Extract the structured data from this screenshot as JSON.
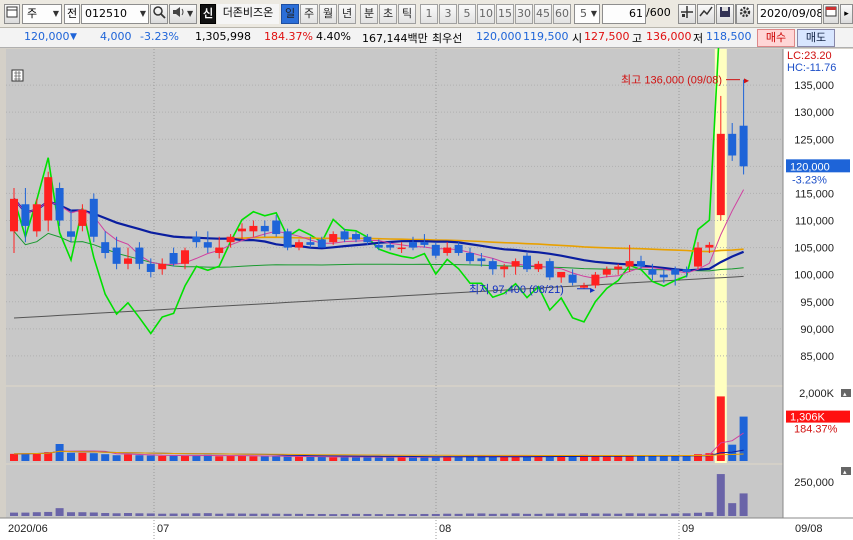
{
  "toolbar": {
    "period_selector": "주",
    "market_selector": "전",
    "code": "012510",
    "stock_name": "더존비즈온",
    "credit_badge": "신",
    "periods": [
      "일",
      "주",
      "월",
      "년",
      "분",
      "초",
      "틱"
    ],
    "active_period": "일",
    "intervals": [
      "1",
      "3",
      "5",
      "10",
      "15",
      "30",
      "45",
      "60"
    ],
    "interval_value": "5",
    "count_value": "61",
    "count_max": "/600",
    "date": "2020/09/08"
  },
  "quote": {
    "price": "120,000",
    "change": "4,000",
    "change_pct": "-3.23%",
    "volume": "1,305,998",
    "volume_ratio": "184.37%",
    "turnover": "4.40%",
    "amount": "167,144백만",
    "priority_label": "최우선",
    "best_ask": "120,000",
    "best_bid": "119,500",
    "open_label": "시",
    "open": "127,500",
    "high_label": "고",
    "high": "136,000",
    "low_label": "저",
    "low": "118,500",
    "buy_label": "매수",
    "sell_label": "매도"
  },
  "chart_data": {
    "type": "candlestick",
    "price_axis": {
      "ylim": [
        80000,
        140000
      ],
      "ticks": [
        "135,000",
        "130,000",
        "125,000",
        "120,000",
        "115,000",
        "110,000",
        "105,000",
        "100,000",
        "95,000",
        "90,000",
        "85,000"
      ]
    },
    "lc_label": "LC:23.20",
    "hc_label": "HC:-11.76",
    "current_price_label": "120,000",
    "current_change_label": "-3.23%",
    "high_annotation": "최고 136,000 (09/08)",
    "low_annotation": "최저 97,400 (08/21)",
    "x_labels": [
      "2020/06",
      "07",
      "08",
      "09",
      "09/08"
    ],
    "candles": [
      {
        "o": 108000,
        "h": 116000,
        "l": 104000,
        "c": 114000
      },
      {
        "o": 113000,
        "h": 116000,
        "l": 106000,
        "c": 109000
      },
      {
        "o": 108000,
        "h": 114000,
        "l": 107000,
        "c": 113000
      },
      {
        "o": 110000,
        "h": 119000,
        "l": 108000,
        "c": 118000
      },
      {
        "o": 116000,
        "h": 117000,
        "l": 109000,
        "c": 110000
      },
      {
        "o": 108000,
        "h": 112000,
        "l": 106000,
        "c": 107000
      },
      {
        "o": 109000,
        "h": 113000,
        "l": 108000,
        "c": 112000
      },
      {
        "o": 114000,
        "h": 115000,
        "l": 106000,
        "c": 107000
      },
      {
        "o": 106000,
        "h": 108000,
        "l": 103000,
        "c": 104000
      },
      {
        "o": 105000,
        "h": 107000,
        "l": 101000,
        "c": 102000
      },
      {
        "o": 102000,
        "h": 105000,
        "l": 101000,
        "c": 103000
      },
      {
        "o": 105000,
        "h": 106000,
        "l": 101000,
        "c": 102000
      },
      {
        "o": 102000,
        "h": 103000,
        "l": 99500,
        "c": 100500
      },
      {
        "o": 101000,
        "h": 103000,
        "l": 100000,
        "c": 102000
      },
      {
        "o": 104000,
        "h": 105000,
        "l": 101500,
        "c": 102000
      },
      {
        "o": 102000,
        "h": 105000,
        "l": 101000,
        "c": 104500
      },
      {
        "o": 107000,
        "h": 108000,
        "l": 105000,
        "c": 106000
      },
      {
        "o": 106000,
        "h": 108000,
        "l": 104000,
        "c": 105000
      },
      {
        "o": 104000,
        "h": 107000,
        "l": 103000,
        "c": 105000
      },
      {
        "o": 106000,
        "h": 107500,
        "l": 105000,
        "c": 107000
      },
      {
        "o": 108000,
        "h": 109500,
        "l": 106500,
        "c": 108500
      },
      {
        "o": 108000,
        "h": 110000,
        "l": 107000,
        "c": 109000
      },
      {
        "o": 109000,
        "h": 110000,
        "l": 107000,
        "c": 108000
      },
      {
        "o": 110000,
        "h": 111000,
        "l": 107000,
        "c": 107500
      },
      {
        "o": 108000,
        "h": 108500,
        "l": 104500,
        "c": 105000
      },
      {
        "o": 105000,
        "h": 106500,
        "l": 104500,
        "c": 106000
      },
      {
        "o": 106000,
        "h": 107000,
        "l": 105000,
        "c": 105500
      },
      {
        "o": 106500,
        "h": 107000,
        "l": 105000,
        "c": 105000
      },
      {
        "o": 106000,
        "h": 108000,
        "l": 105500,
        "c": 107500
      },
      {
        "o": 108000,
        "h": 108500,
        "l": 106000,
        "c": 106500
      },
      {
        "o": 107500,
        "h": 108000,
        "l": 106000,
        "c": 106500
      },
      {
        "o": 107000,
        "h": 107500,
        "l": 105500,
        "c": 106000
      },
      {
        "o": 105500,
        "h": 106500,
        "l": 104500,
        "c": 105000
      },
      {
        "o": 105500,
        "h": 106000,
        "l": 104500,
        "c": 105000
      },
      {
        "o": 105000,
        "h": 106000,
        "l": 104000,
        "c": 105000
      },
      {
        "o": 106000,
        "h": 107000,
        "l": 104500,
        "c": 105000
      },
      {
        "o": 106000,
        "h": 107500,
        "l": 105000,
        "c": 105500
      },
      {
        "o": 105500,
        "h": 106000,
        "l": 103000,
        "c": 103500
      },
      {
        "o": 104000,
        "h": 106000,
        "l": 103500,
        "c": 105000
      },
      {
        "o": 105500,
        "h": 106000,
        "l": 103500,
        "c": 104000
      },
      {
        "o": 104000,
        "h": 105000,
        "l": 102000,
        "c": 102500
      },
      {
        "o": 103000,
        "h": 104000,
        "l": 101500,
        "c": 102500
      },
      {
        "o": 102500,
        "h": 103000,
        "l": 100000,
        "c": 101000
      },
      {
        "o": 101000,
        "h": 102000,
        "l": 99500,
        "c": 101500
      },
      {
        "o": 101500,
        "h": 103000,
        "l": 100000,
        "c": 102500
      },
      {
        "o": 103500,
        "h": 104000,
        "l": 100500,
        "c": 101000
      },
      {
        "o": 101000,
        "h": 102500,
        "l": 100500,
        "c": 102000
      },
      {
        "o": 102500,
        "h": 103000,
        "l": 99000,
        "c": 99500
      },
      {
        "o": 99500,
        "h": 100500,
        "l": 98500,
        "c": 100500
      },
      {
        "o": 100000,
        "h": 101000,
        "l": 98000,
        "c": 98500
      },
      {
        "o": 97600,
        "h": 98500,
        "l": 97400,
        "c": 98000
      },
      {
        "o": 98000,
        "h": 100500,
        "l": 97500,
        "c": 100000
      },
      {
        "o": 100000,
        "h": 101500,
        "l": 99500,
        "c": 101000
      },
      {
        "o": 101000,
        "h": 102000,
        "l": 100000,
        "c": 101500
      },
      {
        "o": 101500,
        "h": 105500,
        "l": 100500,
        "c": 102500
      },
      {
        "o": 102500,
        "h": 103500,
        "l": 101000,
        "c": 101500
      },
      {
        "o": 101000,
        "h": 102000,
        "l": 99000,
        "c": 100000
      },
      {
        "o": 100000,
        "h": 101000,
        "l": 98500,
        "c": 99500
      },
      {
        "o": 101000,
        "h": 101500,
        "l": 98000,
        "c": 100000
      },
      {
        "o": 101000,
        "h": 101500,
        "l": 99500,
        "c": 100500
      },
      {
        "o": 101500,
        "h": 106000,
        "l": 101000,
        "c": 105000
      },
      {
        "o": 105000,
        "h": 106000,
        "l": 104000,
        "c": 105500
      },
      {
        "o": 111000,
        "h": 133000,
        "l": 110000,
        "c": 126000
      },
      {
        "o": 126000,
        "h": 128000,
        "l": 121000,
        "c": 122000
      },
      {
        "o": 127500,
        "h": 136000,
        "l": 118500,
        "c": 120000
      }
    ],
    "volume_axis": {
      "ticks": [
        "2,000K"
      ],
      "current_label": "1,306K",
      "ratio_label": "184.37%"
    },
    "volume": [
      210,
      220,
      230,
      260,
      500,
      240,
      240,
      230,
      200,
      170,
      190,
      170,
      160,
      150,
      160,
      150,
      170,
      180,
      140,
      160,
      150,
      140,
      140,
      140,
      130,
      130,
      120,
      120,
      110,
      120,
      130,
      120,
      110,
      110,
      120,
      110,
      120,
      120,
      140,
      130,
      150,
      160,
      130,
      140,
      160,
      130,
      130,
      150,
      160,
      150,
      180,
      150,
      150,
      140,
      170,
      160,
      150,
      130,
      160,
      170,
      200,
      230,
      1900,
      480,
      1306
    ],
    "amount_axis": {
      "ticks": [
        "250,000"
      ]
    },
    "amount": [
      25,
      25,
      28,
      30,
      58,
      28,
      28,
      26,
      22,
      20,
      22,
      20,
      19,
      17,
      18,
      18,
      20,
      21,
      17,
      19,
      18,
      17,
      17,
      17,
      16,
      16,
      15,
      15,
      14,
      15,
      16,
      15,
      14,
      14,
      15,
      14,
      15,
      15,
      17,
      16,
      18,
      19,
      16,
      17,
      19,
      16,
      16,
      18,
      19,
      18,
      21,
      18,
      18,
      17,
      20,
      19,
      18,
      16,
      19,
      20,
      24,
      28,
      310,
      95,
      167
    ]
  },
  "colors": {
    "up": "#ff2020",
    "down": "#1e64d8",
    "ma5": "#d040a0",
    "ma20": "#0a1ea0",
    "ma60": "#e8a000",
    "ma120": "#1a9a30",
    "ma240": "#555555",
    "env": "#00e000",
    "highlight": "#ffffc0",
    "plot_bg": "#c8c8c8",
    "price_tag": "#1e64d8",
    "vol_tag": "#ff1010"
  }
}
